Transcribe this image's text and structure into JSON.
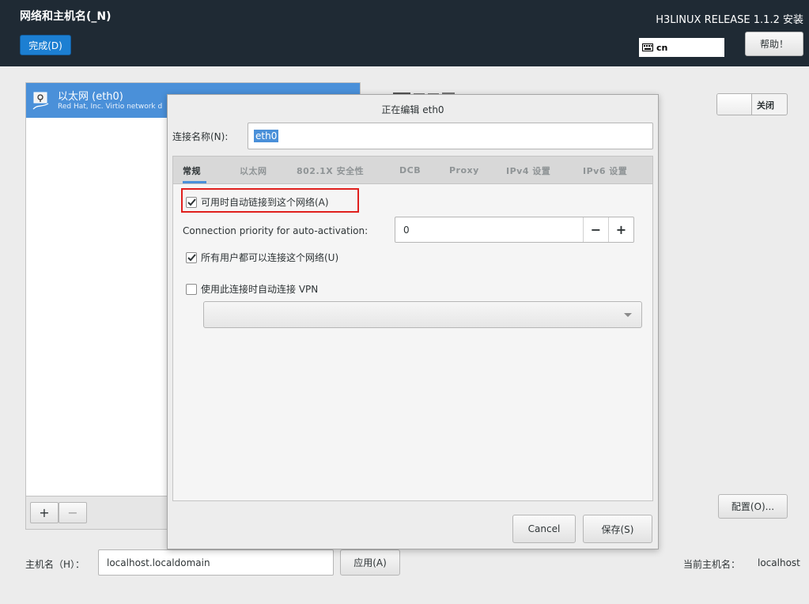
{
  "header": {
    "spoke_title": "网络和主机名(_N)",
    "done_label": "完成(D)",
    "product_title": "H3LINUX RELEASE 1.1.2 安装",
    "keyboard_layout": "cn",
    "help_label": "帮助！"
  },
  "device_list": {
    "items": [
      {
        "name": "以太网 (eth0)",
        "description": "Red Hat, Inc. Virtio network d"
      }
    ],
    "add_label": "+",
    "remove_label": "−"
  },
  "right_panel": {
    "toggle_label": "关闭",
    "config_label": "配置(O)..."
  },
  "hostname": {
    "label": "主机名（H）：",
    "value": "localhost.localdomain",
    "apply_label": "应用(A)",
    "current_label": "当前主机名：",
    "current_value": "localhost"
  },
  "dialog": {
    "title": "正在编辑 eth0",
    "conn_name_label": "连接名称(N):",
    "conn_name_value": "eth0",
    "tabs": [
      {
        "label": "常规",
        "active": true
      },
      {
        "label": "以太网"
      },
      {
        "label": "802.1X 安全性"
      },
      {
        "label": "DCB"
      },
      {
        "label": "Proxy"
      },
      {
        "label": "IPv4 设置"
      },
      {
        "label": "IPv6 设置"
      }
    ],
    "general": {
      "auto_connect_label": "可用时自动链接到这个网络(A)",
      "auto_connect_checked": true,
      "priority_label": "Connection priority for auto-activation:",
      "priority_value": "0",
      "minus_label": "−",
      "plus_label": "+",
      "all_users_label": "所有用户都可以连接这个网络(U)",
      "all_users_checked": true,
      "vpn_label": "使用此连接时自动连接 VPN",
      "vpn_checked": false,
      "vpn_selected": ""
    },
    "cancel_label": "Cancel",
    "save_label": "保存(S)"
  },
  "colors": {
    "header_bg": "#1f2a34",
    "accent_blue": "#4a90d9",
    "done_button": "#1c7fd2",
    "highlight_red": "#e0201e"
  }
}
